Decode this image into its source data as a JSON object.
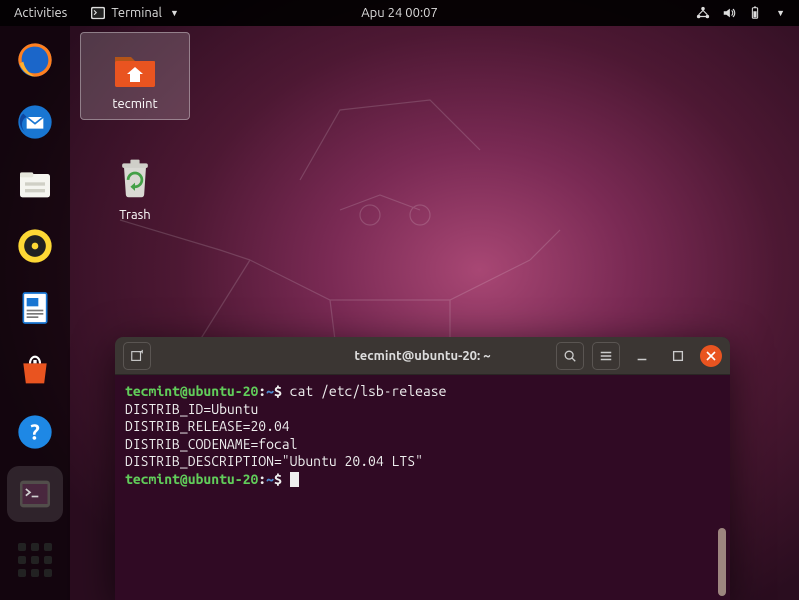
{
  "topbar": {
    "activities": "Activities",
    "app_menu": "Terminal",
    "clock": "Apu 24  00:07"
  },
  "desktop": {
    "home_folder": "tecmint",
    "trash": "Trash"
  },
  "terminal": {
    "title": "tecmint@ubuntu-20: ~",
    "prompt_user_host": "tecmint@ubuntu-20",
    "prompt_sep": ":",
    "prompt_path": "~",
    "prompt_sigil": "$",
    "command": "cat /etc/lsb-release",
    "output_lines": [
      "DISTRIB_ID=Ubuntu",
      "DISTRIB_RELEASE=20.04",
      "DISTRIB_CODENAME=focal",
      "DISTRIB_DESCRIPTION=\"Ubuntu 20.04 LTS\""
    ]
  },
  "dock": {
    "items": [
      "firefox",
      "thunderbird",
      "files",
      "rhythmbox",
      "libreoffice-writer",
      "software-center",
      "help",
      "terminal"
    ]
  }
}
